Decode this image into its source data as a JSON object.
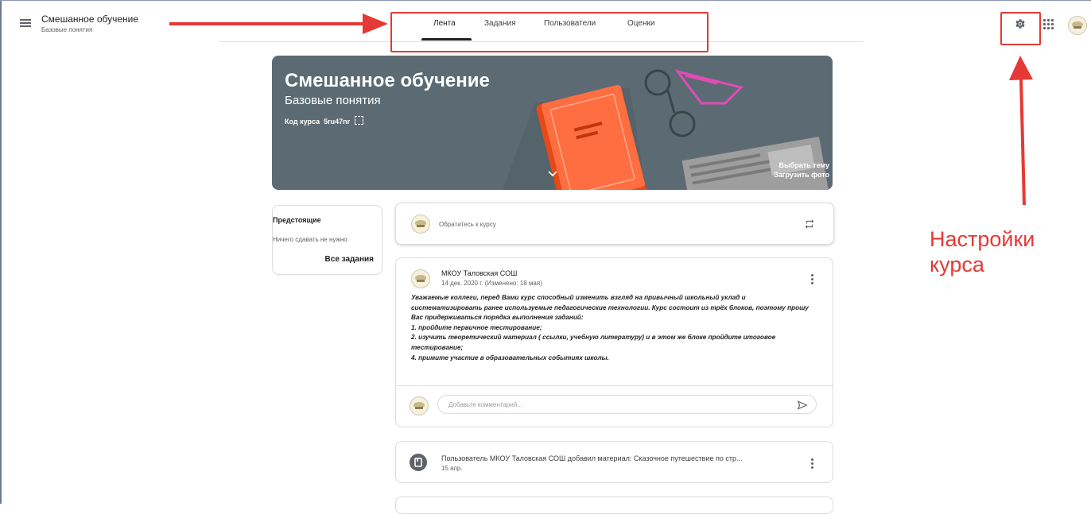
{
  "header": {
    "course_title": "Смешанное обучение",
    "course_subtitle": "Базовые понятия"
  },
  "tabs": [
    {
      "label": "Лента",
      "active": true
    },
    {
      "label": "Задания",
      "active": false
    },
    {
      "label": "Пользователи",
      "active": false
    },
    {
      "label": "Оценки",
      "active": false
    }
  ],
  "toolbar": {
    "icons": [
      "menu-icon",
      "gear-icon",
      "apps-grid-icon",
      "avatar"
    ]
  },
  "banner": {
    "title": "Смешанное обучение",
    "subtitle": "Базовые понятия",
    "code_label": "Код курса",
    "code_value": "5ru47nr",
    "select_theme": "Выбрать тему",
    "upload_photo": "Загрузить фото",
    "background_color": "#5c6b73",
    "book_color": "#ff6e40"
  },
  "upcoming": {
    "title": "Предстоящие",
    "empty_text": "Ничего сдавать не нужно",
    "all_tasks_link": "Все задания"
  },
  "announce": {
    "placeholder": "Обратитесь к курсу"
  },
  "post": {
    "author": "МКОУ Таловская СОШ",
    "date": "14 дек. 2020 г. (Изменено: 18 мая)",
    "body": [
      "Уважаемые коллеги, перед Вами курс способный изменить взгляд на привычный школьный уклад и",
      "систематизировать ранее используемые педагогические технологии. Курс состоит из трёх блоков, поэтому прошу",
      "Вас придерживаться порядка выполнения заданий:",
      "1. пройдите первичное тестирование;",
      "2. изучить теоретический материал ( ссылки, учебную литературу) и в этом же блоке пройдите итоговое",
      "тестирование;",
      "4. примите участие в образовательных событиях школы."
    ],
    "comment_placeholder": "Добавьте комментарий..."
  },
  "material": {
    "title": "Пользователь МКОУ Таловская СОШ добавил материал: Сказочное путешествие по стр...",
    "date": "15 апр."
  },
  "annotation": {
    "label_line1": "Настройки",
    "label_line2": "курса",
    "color": "#e53935"
  }
}
